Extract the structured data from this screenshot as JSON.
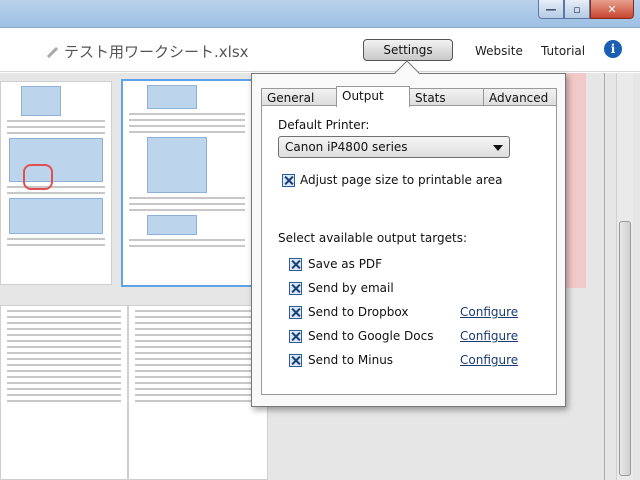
{
  "window": {
    "buttons": {
      "minimize": "—",
      "maximize": "▫",
      "close": "✕"
    }
  },
  "header": {
    "filename": "テスト用ワークシート.xlsx",
    "settings_label": "Settings",
    "website_label": "Website",
    "tutorial_label": "Tutorial",
    "info_label": "i"
  },
  "settings": {
    "tabs": [
      {
        "label": "General"
      },
      {
        "label": "Output"
      },
      {
        "label": "Stats"
      },
      {
        "label": "Advanced"
      }
    ],
    "active_tab": "Output",
    "default_printer_label": "Default Printer:",
    "printer_value": "Canon iP4800 series",
    "adjust_page_label": "Adjust page size to printable area",
    "adjust_page_checked": true,
    "targets_label": "Select available output targets:",
    "targets": [
      {
        "label": "Save as PDF",
        "checked": true,
        "configure": ""
      },
      {
        "label": "Send by email",
        "checked": true,
        "configure": ""
      },
      {
        "label": "Send to Dropbox",
        "checked": true,
        "configure": "Configure"
      },
      {
        "label": "Send to Google Docs",
        "checked": true,
        "configure": "Configure"
      },
      {
        "label": "Send to Minus",
        "checked": true,
        "configure": "Configure"
      }
    ]
  },
  "colors": {
    "accent": "#1a5fb4",
    "selection_border": "#5ea3e8",
    "highlight_panel": "#f2c9c9"
  }
}
